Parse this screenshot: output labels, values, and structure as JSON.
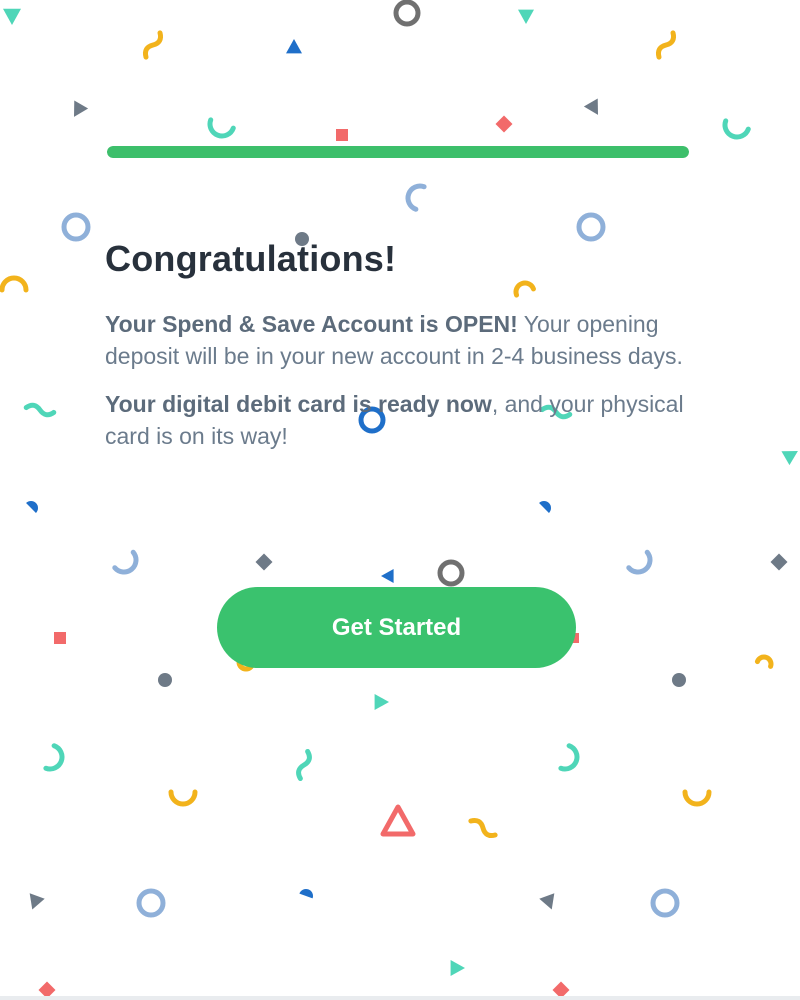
{
  "progress": {
    "value": 1.0,
    "fill_color": "#3dbf6b"
  },
  "main": {
    "title": "Congratulations!",
    "paragraph1": {
      "bold": "Your Spend & Save Account is OPEN!",
      "text": " Your opening deposit will be in your new account in 2-4 business days."
    },
    "paragraph2": {
      "bold": "Your digital debit card is ready now",
      "text": ", and your physical card is on its way!"
    }
  },
  "button": {
    "label": "Get Started",
    "color": "#3ac26e"
  },
  "confetti": {
    "colors": {
      "teal": "#4fd6b8",
      "yellow": "#f2b31c",
      "blue": "#1f6fc9",
      "light_blue": "#8fb0d9",
      "gray": "#6e7a87",
      "red": "#f26a6a",
      "dark_gray": "#707070"
    }
  }
}
